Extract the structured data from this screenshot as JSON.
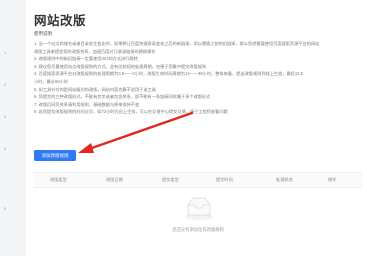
{
  "page": {
    "title": "网站改版",
    "usage_label": "使用说明",
    "instructions": [
      "1. 当一个站点的域名或者目录发生变化时，如果想让百度快速收录变化之后的新链接，用以替换之前的旧链接，那么您就需要使用百度搜索资源平台的网站",
      "改版工具来提交您的改版关系，加速百度对已收录链接的替换操作",
      "2. 改版规则中的新旧链接一定要使用301的方式进行跳转",
      "3. 建议您尽量使用站点改版规则的方式，会有比较短的处理周期，也便于您集中提交改版规则",
      "4. 百度搜索资源平台对改版规则的处理周期为0.5——2小时，改版生效时间周期为12——48小时，整体来看，提出改版规则到线上生效，最短12.5",
      "小时，最长50小时",
      "5. 如工具针对的是网站级别的改版，网站内容也算不适用于该工具",
      "6. 您提交的三种改版形式，不能有交叉或者包含关系，即不能有一条链接同时属于多个改版形式",
      "7. 改版后网页关系请利用规则，基础数据与原来保持不变",
      "8. 若您提交改版规则的时间过早，如72小时仍旧上生效，可以在反馈中心提交反馈，便于工程师查看问题"
    ],
    "left_markers": [
      "1",
      "2",
      "3",
      "4",
      "5"
    ],
    "add_button_label": "添加改版规则",
    "table_columns": [
      "改版类型",
      "改版日期",
      "提交类型",
      "提交时间",
      "处理状态",
      "操作"
    ],
    "empty_text": "您还没有添加任何改版规则"
  },
  "colors": {
    "accent": "#2f7bf5",
    "arrow": "#e0281e"
  }
}
